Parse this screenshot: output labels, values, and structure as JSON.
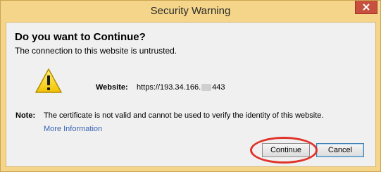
{
  "window": {
    "title": "Security Warning",
    "colors": {
      "frame": "#f4d58a",
      "client": "#f0f0f0",
      "close": "#c7503f",
      "link": "#3a63b4",
      "ring": "#e0332a"
    }
  },
  "dialog": {
    "heading": "Do you want to Continue?",
    "subheading": "The connection to this website is untrusted.",
    "icon": "warning-icon",
    "website_label": "Website:",
    "website_url_start": "https://193.34.166.",
    "website_url_end": "443",
    "note_label": "Note:",
    "note_text": "The certificate is not valid and cannot be used to verify the identity of this website.",
    "more_info_link": "More Information"
  },
  "buttons": {
    "continue": "Continue",
    "cancel": "Cancel"
  }
}
